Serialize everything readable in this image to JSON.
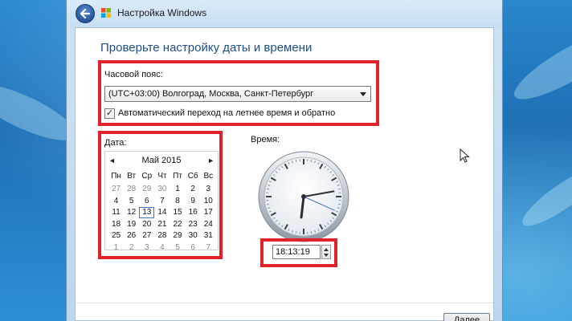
{
  "window": {
    "title": "Настройка Windows"
  },
  "page": {
    "heading": "Проверьте настройку даты и времени"
  },
  "timezone": {
    "label": "Часовой пояс:",
    "selected": "(UTC+03:00) Волгоград, Москва, Санкт-Петербург",
    "dst_checkbox_label": "Автоматический переход на летнее время и обратно",
    "dst_checked": true
  },
  "date": {
    "label": "Дата:",
    "month_title": "Май 2015",
    "weekdays": [
      "Пн",
      "Вт",
      "Ср",
      "Чт",
      "Пт",
      "Сб",
      "Вс"
    ],
    "weeks": [
      [
        "27",
        "28",
        "29",
        "30",
        "1",
        "2",
        "3"
      ],
      [
        "4",
        "5",
        "6",
        "7",
        "8",
        "9",
        "10"
      ],
      [
        "11",
        "12",
        "13",
        "14",
        "15",
        "16",
        "17"
      ],
      [
        "18",
        "19",
        "20",
        "21",
        "22",
        "23",
        "24"
      ],
      [
        "25",
        "26",
        "27",
        "28",
        "29",
        "30",
        "31"
      ],
      [
        "1",
        "2",
        "3",
        "4",
        "5",
        "6",
        "7"
      ]
    ],
    "selected_day": "13"
  },
  "time": {
    "label": "Время:",
    "value": "18:13:19",
    "hours": 18,
    "minutes": 13,
    "seconds": 19
  },
  "footer": {
    "next_label": "Далее"
  },
  "colors": {
    "highlight_border": "#e0222b",
    "heading": "#1d4e8a"
  }
}
